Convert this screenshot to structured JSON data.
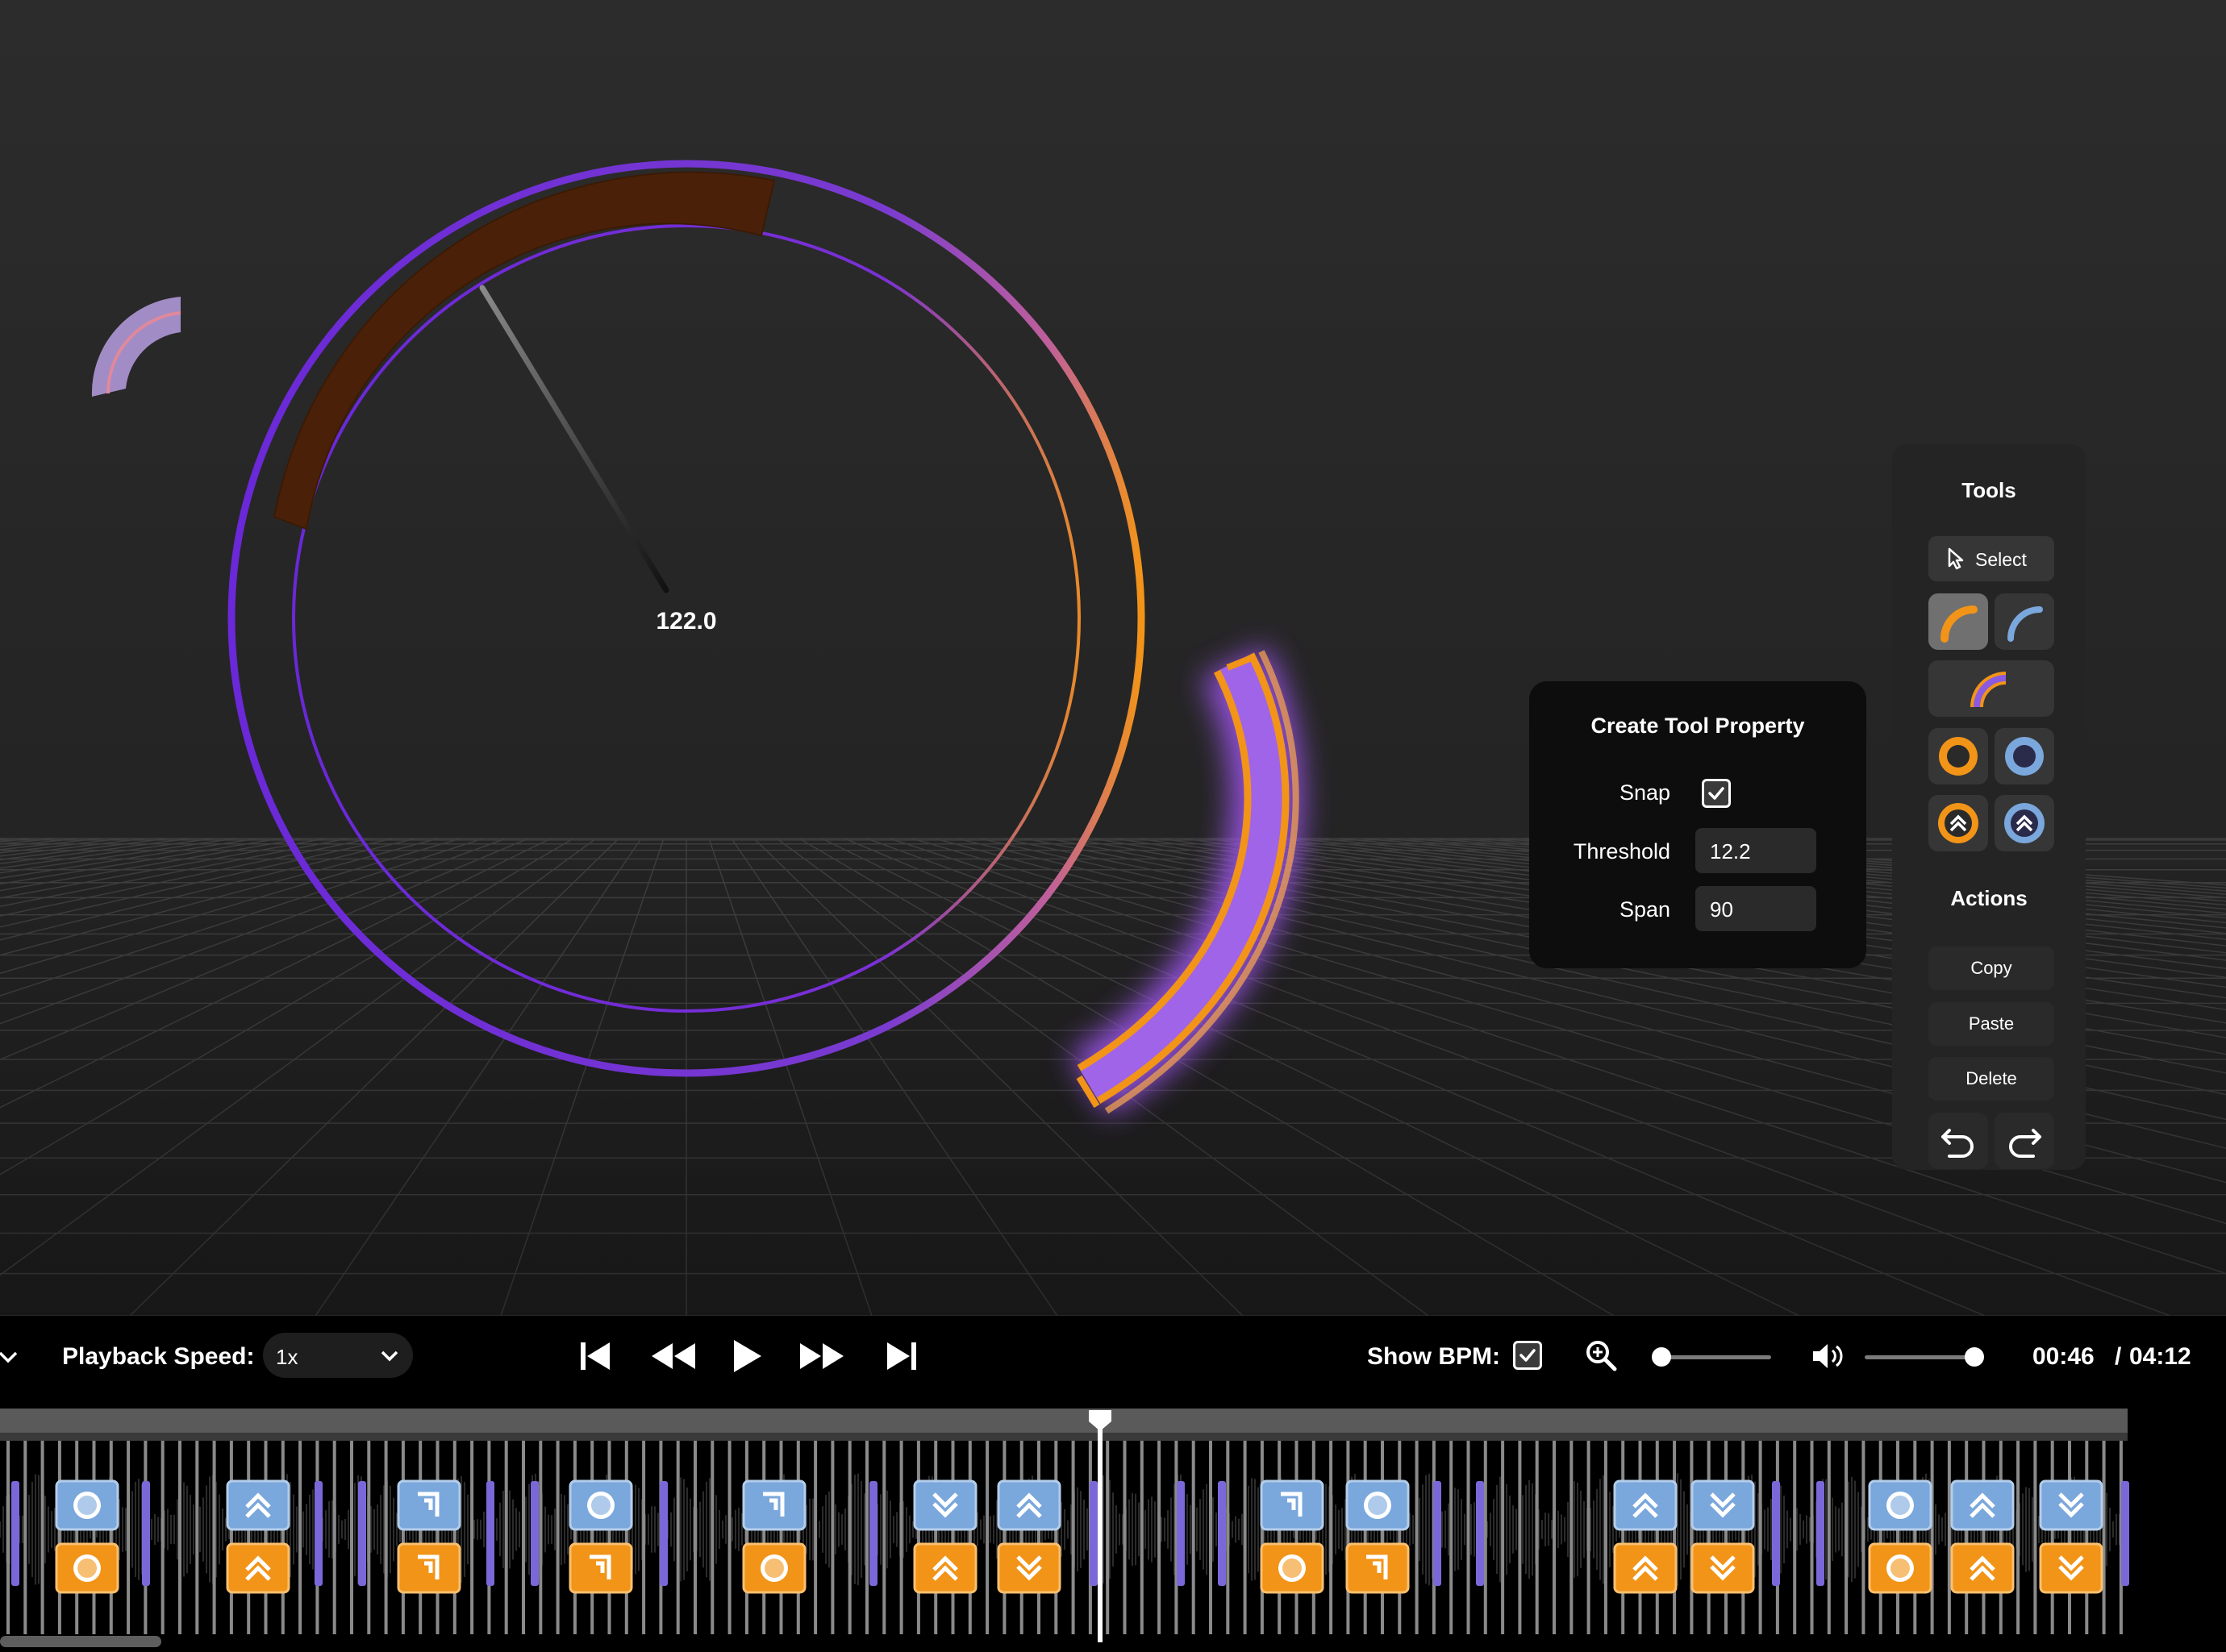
{
  "scene": {
    "dial_value": "122.0",
    "colors": {
      "purple": "#6a28d8",
      "orange": "#f29418",
      "brown": "#4a2108",
      "blue": "#7aa7dc",
      "lilac": "#b79de0"
    }
  },
  "create_tool_property": {
    "title": "Create Tool Property",
    "snap_label": "Snap",
    "snap_checked": true,
    "threshold_label": "Threshold",
    "threshold_value": "12.2",
    "span_label": "Span",
    "span_value": "90"
  },
  "tools_panel": {
    "title": "Tools",
    "select_label": "Select",
    "tools": [
      {
        "name": "orange-arc-tool",
        "active": true
      },
      {
        "name": "blue-arc-tool",
        "active": false
      },
      {
        "name": "combined-arc-tool",
        "active": false
      },
      {
        "name": "orange-circle-tool",
        "active": false
      },
      {
        "name": "blue-circle-tool",
        "active": false
      },
      {
        "name": "orange-double-chevron-tool",
        "active": false
      },
      {
        "name": "blue-double-chevron-tool",
        "active": false
      }
    ],
    "actions_title": "Actions",
    "copy_label": "Copy",
    "paste_label": "Paste",
    "delete_label": "Delete",
    "undo_icon": "undo-icon",
    "redo_icon": "redo-icon"
  },
  "playback": {
    "speed_label": "Playback Speed:",
    "speed_value": "1x",
    "show_bpm_label": "Show BPM:",
    "show_bpm_checked": true,
    "zoom_level": 0.0,
    "volume_level": 1.0,
    "current_time": "00:46",
    "separator": "/",
    "total_time": "04:12",
    "transport_icons": [
      "skip-to-start-icon",
      "rewind-icon",
      "play-icon",
      "fast-forward-icon",
      "skip-to-end-icon"
    ]
  },
  "timeline": {
    "playhead_icon": "playhead-icon",
    "note_icons": [
      "circle-note-icon",
      "double-chevron-up-icon",
      "double-chevron-down-icon",
      "corner-arrow-icon"
    ]
  }
}
